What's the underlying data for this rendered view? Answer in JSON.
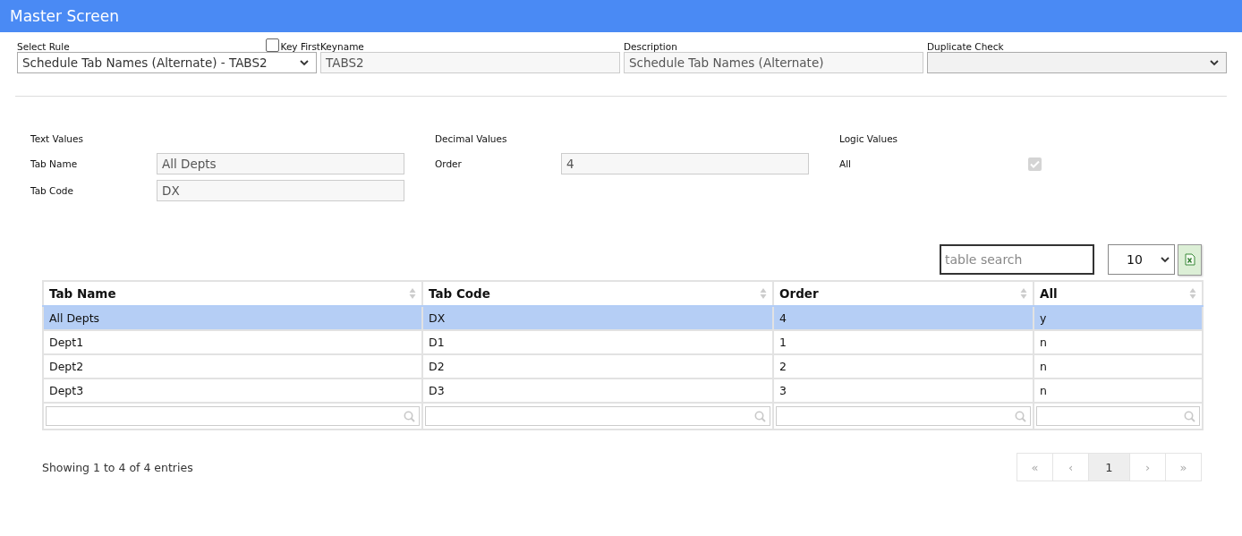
{
  "header": {
    "title": "Master Screen"
  },
  "form": {
    "select_rule": {
      "label": "Select Rule",
      "value": "Schedule Tab Names (Alternate) - TABS2"
    },
    "key_first": {
      "label": "Key First",
      "checked": false
    },
    "keyname": {
      "label": "Keyname",
      "value": "TABS2"
    },
    "description": {
      "label": "Description",
      "value": "Schedule Tab Names (Alternate)"
    },
    "duplicate_check": {
      "label": "Duplicate Check"
    }
  },
  "value_groups": [
    {
      "title": "Text Values",
      "fields": [
        {
          "kind": "text",
          "label": "Tab Name",
          "value": "All Depts"
        },
        {
          "kind": "text",
          "label": "Tab Code",
          "value": "DX"
        }
      ]
    },
    {
      "title": "Decimal Values",
      "fields": [
        {
          "kind": "text",
          "label": "Order",
          "value": "4"
        }
      ]
    },
    {
      "title": "Logic Values",
      "fields": [
        {
          "kind": "checkbox",
          "label": "All",
          "checked": true
        }
      ]
    }
  ],
  "table_search": {
    "placeholder": "table search"
  },
  "page_size": "10",
  "table": {
    "columns": [
      "Tab Name",
      "Tab Code",
      "Order",
      "All"
    ],
    "rows": [
      {
        "cells": [
          "All Depts",
          "DX",
          "4",
          "y"
        ],
        "selected": true
      },
      {
        "cells": [
          "Dept1",
          "D1",
          "1",
          "n"
        ],
        "selected": false
      },
      {
        "cells": [
          "Dept2",
          "D2",
          "2",
          "n"
        ],
        "selected": false
      },
      {
        "cells": [
          "Dept3",
          "D3",
          "3",
          "n"
        ],
        "selected": false
      }
    ]
  },
  "footer": {
    "info": "Showing 1 to 4 of 4 entries"
  },
  "pagination": [
    {
      "label": "«",
      "selected": false
    },
    {
      "label": "‹",
      "selected": false
    },
    {
      "label": "1",
      "selected": true
    },
    {
      "label": "›",
      "selected": false
    },
    {
      "label": "»",
      "selected": false
    }
  ]
}
